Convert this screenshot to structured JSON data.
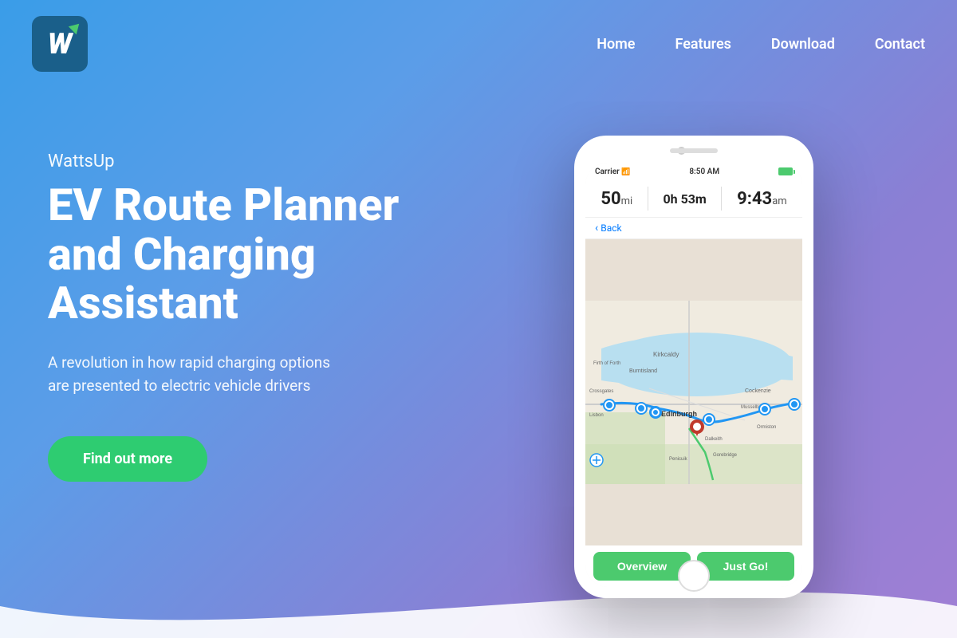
{
  "brand": {
    "logo_letter": "W",
    "app_name": "WattsUp"
  },
  "nav": {
    "items": [
      {
        "label": "Home",
        "id": "nav-home"
      },
      {
        "label": "Features",
        "id": "nav-features"
      },
      {
        "label": "Download",
        "id": "nav-download"
      },
      {
        "label": "Contact",
        "id": "nav-contact"
      }
    ]
  },
  "hero": {
    "app_label": "WattsUp",
    "title": "EV Route Planner and Charging Assistant",
    "description": "A revolution in how rapid charging options are presented to electric vehicle drivers",
    "cta_label": "Find out more"
  },
  "phone": {
    "status_bar": {
      "carrier": "Carrier",
      "time": "8:50 AM"
    },
    "route": {
      "distance_value": "50",
      "distance_unit": "mi",
      "duration_value": "0h 53m",
      "arrival_value": "9:43",
      "arrival_unit": "am"
    },
    "back_label": "Back",
    "buttons": {
      "overview": "Overview",
      "just_go": "Just Go!"
    }
  }
}
